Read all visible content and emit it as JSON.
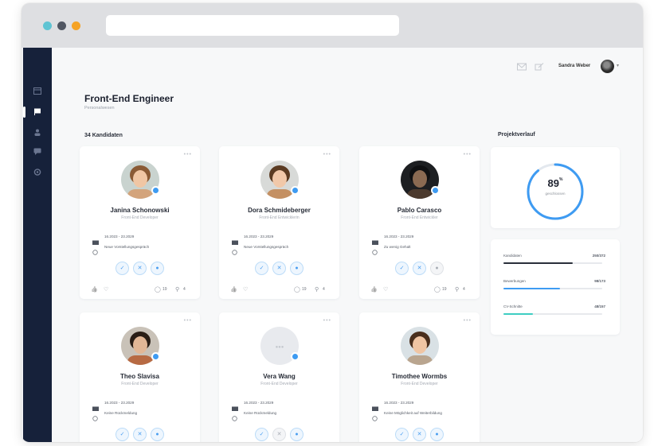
{
  "colors": {
    "sidebar": "#16213a",
    "accent": "#3e9bf2",
    "dot_red": "#f26d5b",
    "dot_dark": "#555b66",
    "dot_orange": "#f5a325",
    "ring_track": "#e3e8ee",
    "bar_dark": "#2a2f3a",
    "bar_blue": "#3e9bf2",
    "bar_teal": "#3ecdc2"
  },
  "topbar": {
    "user_name": "Sandra Weber",
    "icons": [
      "mail-icon",
      "edit-icon"
    ]
  },
  "sidebar": {
    "items": [
      "dashboard-icon",
      "flag-icon",
      "user-icon",
      "chat-icon",
      "settings-icon"
    ],
    "active_index": 1
  },
  "page": {
    "title": "Front-End Engineer",
    "subtitle": "Personalwesen"
  },
  "candidates_section": {
    "label": "34 Kandidaten"
  },
  "progress_section": {
    "label": "Projektverlauf",
    "percent": 89,
    "percent_text": "89",
    "percent_sup": "%",
    "percent_label": "geschlossen"
  },
  "stats": [
    {
      "label": "Kandidaten",
      "value": "250/372",
      "fraction": 0.7,
      "color_key": "bar_dark"
    },
    {
      "label": "Bewerbungen",
      "value": "98/173",
      "fraction": 0.57,
      "color_key": "bar_blue"
    },
    {
      "label": "CV-Schnitte",
      "value": "48/157",
      "fraction": 0.3,
      "color_key": "bar_teal"
    }
  ],
  "candidates": [
    {
      "name": "Janina Schonowski",
      "role": "Front-End Developer",
      "date": "16.2023 - 23.2029",
      "note": "Neue Vorstellungsgespräch",
      "avatar": "photo-woman",
      "buttons": [
        "blue",
        "blue",
        "blue"
      ],
      "comments": "19",
      "files": "4",
      "status": true
    },
    {
      "name": "Dora Schmideberger",
      "role": "Front-End Entwicklerin",
      "date": "16.2023 - 23.2029",
      "note": "Neue Vorstellungsgespräch",
      "avatar": "photo-woman-curly",
      "buttons": [
        "blue",
        "blue",
        "blue"
      ],
      "comments": "19",
      "files": "4",
      "status": true
    },
    {
      "name": "Pablo Carasco",
      "role": "Front-End Entwickler",
      "date": "16.2023 - 23.2029",
      "note": "Zu wenig Gehalt",
      "avatar": "photo-man-dark",
      "buttons": [
        "blue",
        "blue",
        "grey"
      ],
      "comments": "19",
      "files": "4",
      "status": true
    },
    {
      "name": "Theo Slavisa",
      "role": "Front-End Developer",
      "date": "16.2023 - 23.2029",
      "note": "Keine Rückmeldung",
      "avatar": "photo-man-glasses",
      "buttons": [
        "blue",
        "blue",
        "blue"
      ],
      "comments": "",
      "files": "",
      "status": true
    },
    {
      "name": "Vera Wang",
      "role": "Front-End Developer",
      "date": "16.2023 - 23.2029",
      "note": "Keine Rückmeldung",
      "avatar": "placeholder",
      "buttons": [
        "blue",
        "grey",
        "blue"
      ],
      "comments": "",
      "files": "",
      "status": true
    },
    {
      "name": "Timothee Wormbs",
      "role": "Front-End Developer",
      "date": "16.2023 - 23.2029",
      "note": "Keine Möglichkeit auf Weiterbildung",
      "avatar": "photo-man-curly",
      "buttons": [
        "blue",
        "blue",
        "blue"
      ],
      "comments": "",
      "files": "",
      "status": false
    }
  ]
}
